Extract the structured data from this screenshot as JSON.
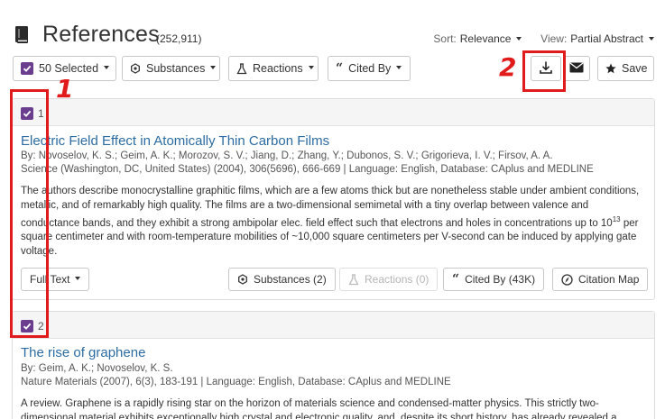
{
  "header": {
    "title": "References",
    "count": "(252,911)",
    "sort_label": "Sort:",
    "sort_value": "Relevance",
    "view_label": "View:",
    "view_value": "Partial Abstract"
  },
  "toolbar": {
    "selected": "50 Selected",
    "substances": "Substances",
    "reactions": "Reactions",
    "cited_by": "Cited By",
    "save": "Save"
  },
  "annotations": {
    "one": "1",
    "two": "2"
  },
  "results": [
    {
      "index": "1",
      "title": "Electric Field Effect in Atomically Thin Carbon Films",
      "authors": "By: Novoselov, K. S.; Geim, A. K.; Morozov, S. V.; Jiang, D.; Zhang, Y.; Dubonos, S. V.; Grigorieva, I. V.; Firsov, A. A.",
      "source": "Science (Washington, DC, United States) (2004), 306(5696), 666-669 | Language: English, Database: CAplus and MEDLINE",
      "abstract_a": "The authors describe monocrystalline graphitic films, which are a few atoms thick but are nonetheless stable under ambient conditions, metallic, and of remarkably high quality. The films are a two-dimensional semimetal with a tiny overlap between valence and conductance bands, and they exhibit a strong ambipolar elec. field effect such that electrons and holes in concentrations up to 10",
      "abstract_sup": "13",
      "abstract_b": " per square centimeter and with room-temperature mobilities of ~10,000 square centimeters per V-second can be induced by applying gate voltage.",
      "full_text": "Full Text",
      "substances": "Substances (2)",
      "reactions": "Reactions (0)",
      "cited_by": "Cited By (43K)",
      "citation_map": "Citation Map"
    },
    {
      "index": "2",
      "title": "The rise of graphene",
      "authors": "By: Geim, A. K.; Novoselov, K. S.",
      "source": "Nature Materials (2007), 6(3), 183-191 | Language: English, Database: CAplus and MEDLINE",
      "abstract_a": "A review. Graphene is a rapidly rising star on the horizon of materials science and condensed-matter physics. This strictly two-dimensional material exhibits exceptionally high crystal and electronic quality, and, despite its short history, has already revealed a"
    }
  ],
  "colors": {
    "accent": "#6a3d8f",
    "link": "#2d6ca2",
    "annotation": "#e11b1b"
  }
}
